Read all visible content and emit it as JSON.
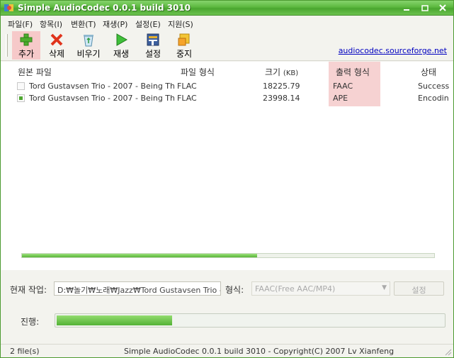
{
  "window": {
    "title": "Simple AudioCodec 0.0.1 build 3010"
  },
  "menu": [
    {
      "label": "파일(F)"
    },
    {
      "label": "항목(I)"
    },
    {
      "label": "변환(T)"
    },
    {
      "label": "재생(P)"
    },
    {
      "label": "설정(E)"
    },
    {
      "label": "지원(S)"
    }
  ],
  "toolbar": {
    "add": "추가",
    "delete": "삭제",
    "clear": "비우기",
    "play": "재생",
    "settings": "설정",
    "stop": "중지",
    "link": "audiocodec.sourceforge.net"
  },
  "list": {
    "columns": {
      "source": "원본 파일",
      "format": "파일 형식",
      "size": "크기",
      "size_unit": "(KB)",
      "output": "출력 형식",
      "status": "상태"
    },
    "rows": [
      {
        "checked": false,
        "source": "Tord Gustavsen Trio - 2007 - Being The...",
        "format": "FLAC",
        "size": "18225.79",
        "output": "FAAC",
        "status": "Success"
      },
      {
        "checked": true,
        "source": "Tord Gustavsen Trio - 2007 - Being The...",
        "format": "FLAC",
        "size": "23998.14",
        "output": "APE",
        "status": "Encodin"
      }
    ],
    "scroll_progress": 0.57
  },
  "current_job": {
    "label": "현재 작업:",
    "value": "D:₩놀기₩노래₩Jazz₩Tord Gustavsen Trio -"
  },
  "format": {
    "label": "형식:",
    "value": "FAAC(Free AAC/MP4)",
    "button": "설정"
  },
  "progress": {
    "label": "진행:",
    "fraction": 0.3
  },
  "status": {
    "files": "2 file(s)",
    "copyright": "Simple AudioCodec 0.0.1 build 3010 - Copyright(C) 2007 Lv Xianfeng"
  },
  "colors": {
    "accent": "#5cb83f",
    "highlight_column": "#f6d2d2",
    "link": "#0000c0"
  }
}
